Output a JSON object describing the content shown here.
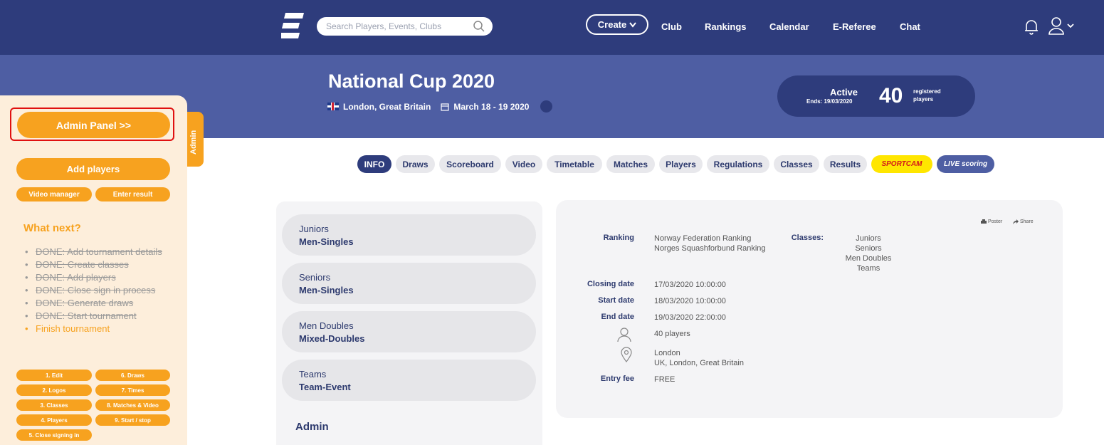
{
  "nav": {
    "search_placeholder": "Search Players, Events, Clubs",
    "create_label": "Create",
    "links": [
      "Club",
      "Rankings",
      "Calendar",
      "E-Referee",
      "Chat"
    ]
  },
  "hero": {
    "title": "National Cup 2020",
    "location": "London, Great Britain",
    "dates": "March 18 - 19 2020",
    "status": "Active",
    "ends": "Ends: 19/03/2020",
    "registered_count": "40",
    "registered_label_1": "registered",
    "registered_label_2": "players"
  },
  "sidebar": {
    "admin_tab": "Admin",
    "admin_panel": "Admin Panel >>",
    "add_players": "Add players",
    "video_manager": "Video manager",
    "enter_result": "Enter result",
    "what_next": "What next?",
    "steps": [
      "DONE: Add tournament details",
      "DONE: Create classes",
      "DONE: Add players",
      "DONE: Close sign in process",
      "DONE: Generate draws",
      "DONE: Start tournament",
      "Finish tournament"
    ],
    "quick": [
      "1. Edit",
      "6. Draws",
      "2. Logos",
      "7. Times",
      "3. Classes",
      "8. Matches & Video",
      "4. Players",
      "9. Start / stop",
      "5. Close signing in"
    ]
  },
  "tabs": [
    "INFO",
    "Draws",
    "Scoreboard",
    "Video",
    "Timetable",
    "Matches",
    "Players",
    "Regulations",
    "Classes",
    "Results",
    "SPORTCAM",
    "LIVE scoring"
  ],
  "classes": [
    {
      "category": "Juniors",
      "type": "Men-Singles"
    },
    {
      "category": "Seniors",
      "type": "Men-Singles"
    },
    {
      "category": "Men Doubles",
      "type": "Mixed-Doubles"
    },
    {
      "category": "Teams",
      "type": "Team-Event"
    }
  ],
  "admin_heading": "Admin",
  "info": {
    "poster": "Poster",
    "share": "Share",
    "ranking_label": "Ranking",
    "ranking_1": "Norway Federation Ranking",
    "ranking_2": "Norges Squashforbund Ranking",
    "classes_label": "Classes:",
    "class_list": [
      "Juniors",
      "Seniors",
      "Men Doubles",
      "Teams"
    ],
    "closing_label": "Closing date",
    "closing": "17/03/2020 10:00:00",
    "start_label": "Start date",
    "start": "18/03/2020 10:00:00",
    "end_label": "End date",
    "end": "19/03/2020 22:00:00",
    "players": "40 players",
    "location_1": "London",
    "location_2": "UK, London, Great Britain",
    "fee_label": "Entry fee",
    "fee": "FREE"
  }
}
